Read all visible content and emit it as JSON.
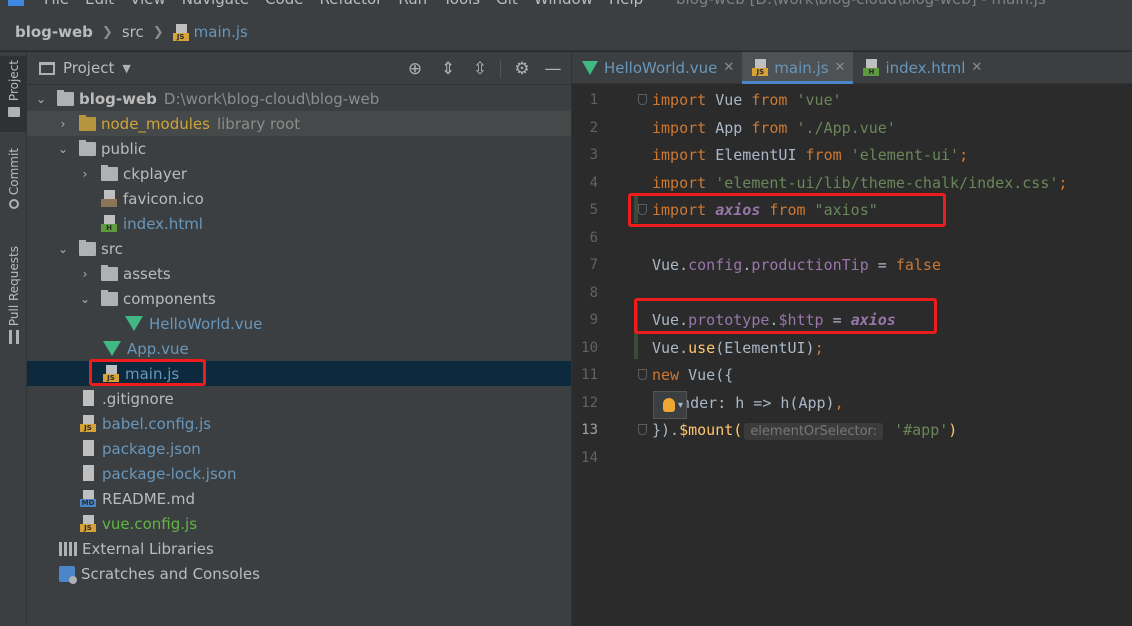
{
  "menubar": {
    "items": [
      "File",
      "Edit",
      "View",
      "Navigate",
      "Code",
      "Refactor",
      "Run",
      "Tools",
      "Git",
      "Window",
      "Help"
    ],
    "window_title": "blog-web [D:\\work\\blog-cloud\\blog-web] - main.js"
  },
  "breadcrumb": {
    "project": "blog-web",
    "folder": "src",
    "file": "main.js"
  },
  "tool_stripe": {
    "project": "Project",
    "commit": "Commit",
    "pull_requests": "Pull Requests"
  },
  "project_panel": {
    "title": "Project",
    "tree": [
      {
        "label": "blog-web",
        "path": "D:\\work\\blog-cloud\\blog-web"
      },
      {
        "label": "node_modules",
        "note": "library root"
      },
      {
        "label": "public"
      },
      {
        "label": "ckplayer"
      },
      {
        "label": "favicon.ico"
      },
      {
        "label": "index.html"
      },
      {
        "label": "src"
      },
      {
        "label": "assets"
      },
      {
        "label": "components"
      },
      {
        "label": "HelloWorld.vue"
      },
      {
        "label": "App.vue"
      },
      {
        "label": "main.js"
      },
      {
        "label": ".gitignore"
      },
      {
        "label": "babel.config.js"
      },
      {
        "label": "package.json"
      },
      {
        "label": "package-lock.json"
      },
      {
        "label": "README.md"
      },
      {
        "label": "vue.config.js"
      },
      {
        "label": "External Libraries"
      },
      {
        "label": "Scratches and Consoles"
      }
    ]
  },
  "editor": {
    "tabs": [
      {
        "label": "HelloWorld.vue"
      },
      {
        "label": "main.js"
      },
      {
        "label": "index.html"
      }
    ],
    "line_numbers": [
      "1",
      "2",
      "3",
      "4",
      "5",
      "6",
      "7",
      "8",
      "9",
      "10",
      "11",
      "12",
      "13",
      "14"
    ],
    "code": {
      "l1": [
        "import",
        " Vue ",
        "from",
        " 'vue'"
      ],
      "l2": [
        "import",
        " App ",
        "from",
        " './App.vue'"
      ],
      "l3": [
        "import",
        " ElementUI ",
        "from",
        " 'element-ui'",
        ";"
      ],
      "l4": [
        "import",
        " 'element-ui/lib/theme-chalk/index.css'",
        ";"
      ],
      "l5": [
        "import",
        " ",
        "axios",
        " ",
        "from",
        " \"axios\""
      ],
      "l7": [
        "Vue",
        ".",
        "config",
        ".",
        "productionTip",
        " = ",
        "false"
      ],
      "l9": [
        "Vue",
        ".",
        "prototype",
        ".",
        "$http",
        " = ",
        "axios"
      ],
      "l10": [
        "Vue",
        ".",
        "use",
        "(ElementUI)",
        ";"
      ],
      "l11": [
        "new",
        " Vue({"
      ],
      "l12": [
        "render",
        ": h => h(App)",
        ","
      ],
      "l13": [
        "}).",
        "$mount",
        "(",
        "elementOrSelector:",
        " '#app'",
        ")"
      ]
    }
  },
  "colors": {
    "keyword": "#cc7832",
    "string": "#6a8759",
    "property": "#9876aa",
    "highlight_box": "#ee1c1c",
    "selection": "#0d293e"
  }
}
